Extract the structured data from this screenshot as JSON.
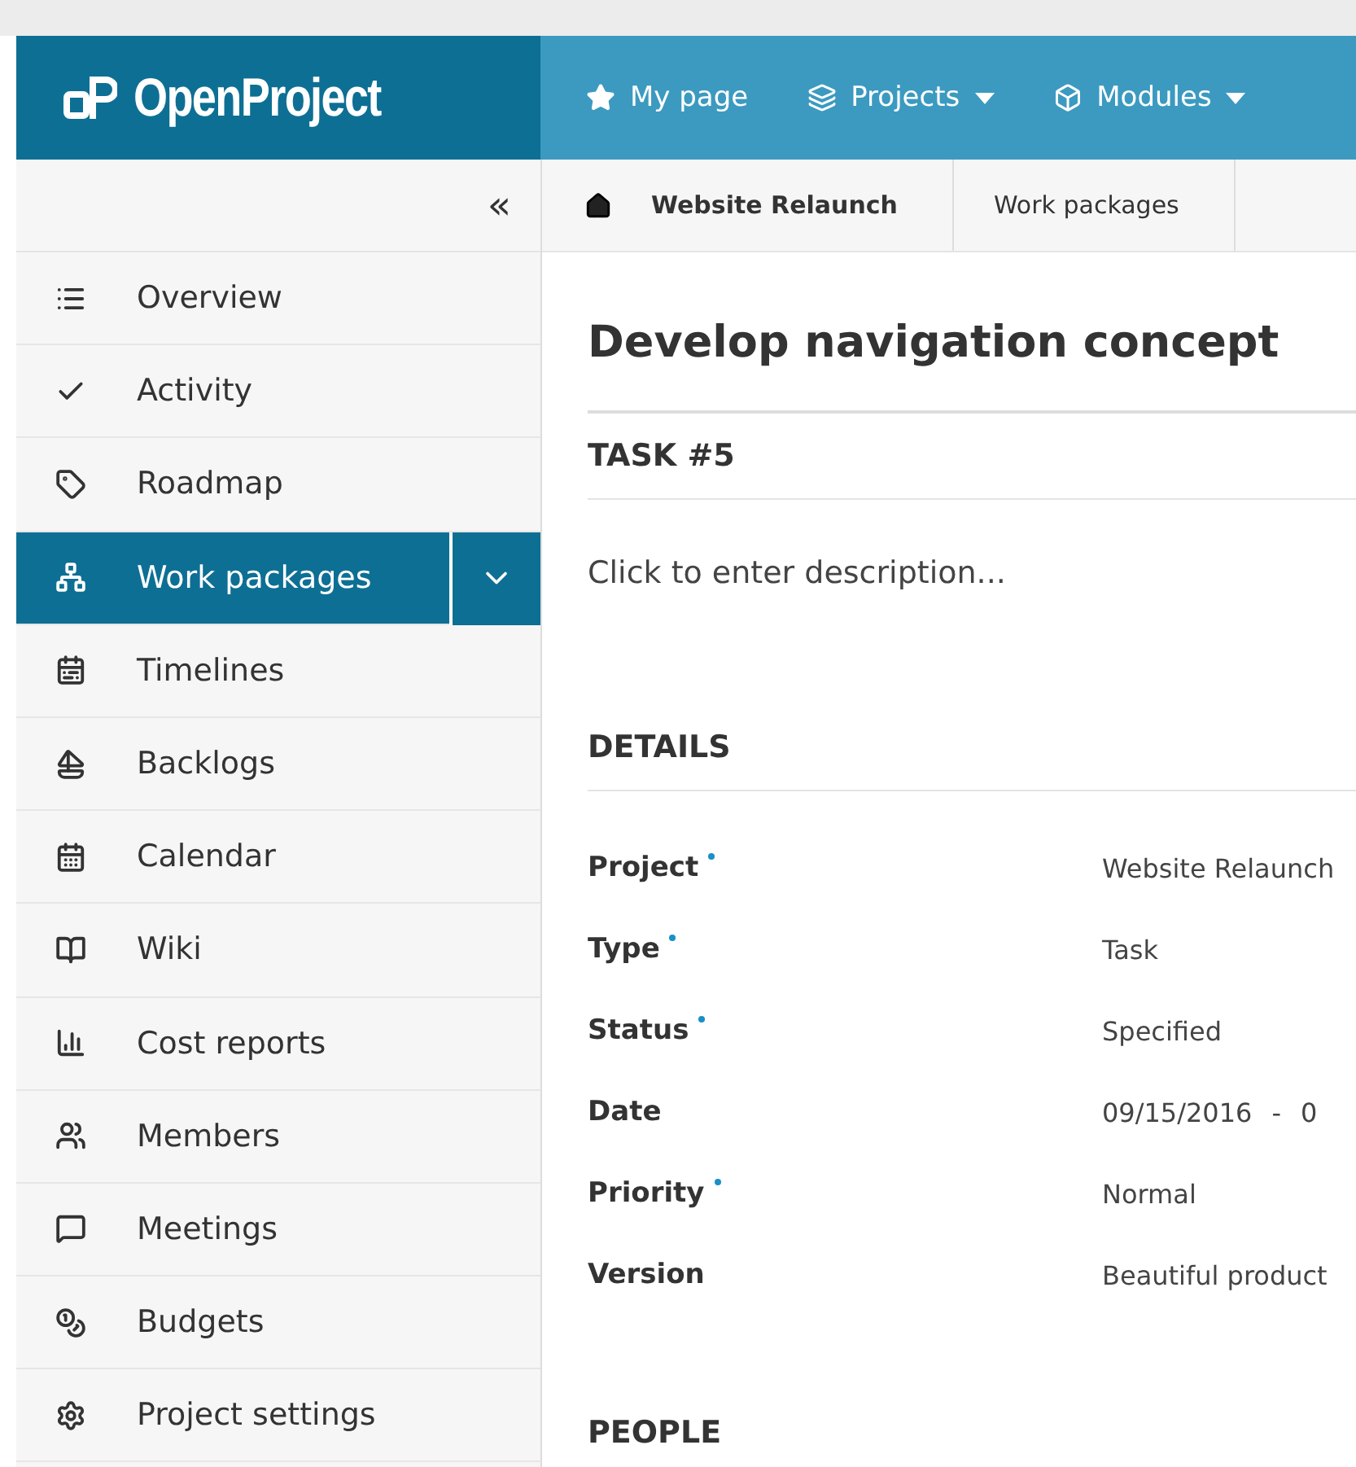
{
  "logo": {
    "text": "OpenProject"
  },
  "top_menu": [
    {
      "label": "My page",
      "dropdown": false
    },
    {
      "label": "Projects",
      "dropdown": true
    },
    {
      "label": "Modules",
      "dropdown": true
    }
  ],
  "sidebar": {
    "collapse": "«",
    "items": [
      {
        "label": "Overview",
        "selected": false
      },
      {
        "label": "Activity",
        "selected": false
      },
      {
        "label": "Roadmap",
        "selected": false
      },
      {
        "label": "Work packages",
        "selected": true
      },
      {
        "label": "Timelines",
        "selected": false
      },
      {
        "label": "Backlogs",
        "selected": false
      },
      {
        "label": "Calendar",
        "selected": false
      },
      {
        "label": "Wiki",
        "selected": false
      },
      {
        "label": "Cost reports",
        "selected": false
      },
      {
        "label": "Members",
        "selected": false
      },
      {
        "label": "Meetings",
        "selected": false
      },
      {
        "label": "Budgets",
        "selected": false
      },
      {
        "label": "Project settings",
        "selected": false
      }
    ]
  },
  "breadcrumb": [
    {
      "label": "Website Relaunch",
      "bold": true
    },
    {
      "label": "Work packages",
      "bold": false
    }
  ],
  "work_package": {
    "title": "Develop navigation concept",
    "type_id": "TASK #5",
    "description_placeholder": "Click to enter description...",
    "details_heading": "DETAILS",
    "fields": [
      {
        "label": "Project",
        "required": true,
        "value": "Website Relaunch"
      },
      {
        "label": "Type",
        "required": true,
        "value": "Task"
      },
      {
        "label": "Status",
        "required": true,
        "value": "Specified"
      },
      {
        "label": "Date",
        "required": false,
        "value": "09/15/2016",
        "separator": "-",
        "end": "0"
      },
      {
        "label": "Priority",
        "required": true,
        "value": "Normal"
      },
      {
        "label": "Version",
        "required": false,
        "value": "Beautiful product"
      }
    ],
    "people_heading": "PEOPLE"
  }
}
